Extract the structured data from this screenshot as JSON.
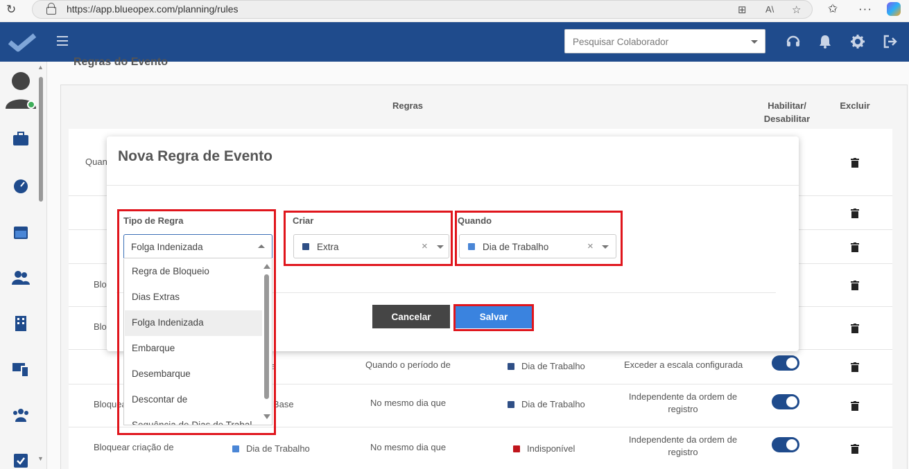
{
  "browser": {
    "url": "https://app.blueopex.com/planning/rules"
  },
  "topnav": {
    "search_placeholder": "Pesquisar Colaborador"
  },
  "page": {
    "section_title": "Regras do Evento",
    "columns": {
      "rules": "Regras",
      "enable": "Habilitar/\nDesabilitar",
      "delete": "Excluir"
    },
    "rows": [
      {
        "c1": "Quan",
        "c2": "",
        "c3": "",
        "c4": "",
        "c5": ""
      },
      {
        "c1": "",
        "c2": "",
        "c3": "",
        "c4": "",
        "c5": ""
      },
      {
        "c1": "",
        "c2": "",
        "c3": "",
        "c4": "",
        "c5": ""
      },
      {
        "c1": "Bloq",
        "c2": "",
        "c3": "",
        "c4": "",
        "c5": ""
      },
      {
        "c1": "Blo",
        "c2": "",
        "c3": "",
        "c4": "",
        "c5": ""
      },
      {
        "c1": "",
        "c2": "bra",
        "c3": "Quando o período de",
        "c4": "Dia de Trabalho",
        "c5": "Exceder a escala configurada"
      },
      {
        "c1": "Bloquea",
        "c2": "o na Base",
        "c3": "No mesmo dia que",
        "c4": "Dia de Trabalho",
        "c5": "Independente da ordem de registro"
      },
      {
        "c1": "Bloquear criação de",
        "c2": "Dia de Trabalho",
        "c3": "No mesmo dia que",
        "c4": "Indisponível",
        "c5": "Independente da ordem de registro"
      }
    ]
  },
  "modal": {
    "title": "Nova Regra de Evento",
    "tipo_label": "Tipo de Regra",
    "tipo_value": "Folga Indenizada",
    "criar_label": "Criar",
    "criar_value": "Extra",
    "quando_label": "Quando",
    "quando_value": "Dia de Trabalho",
    "cancel_label": "Cancelar",
    "save_label": "Salvar",
    "options": [
      "Regra de Bloqueio",
      "Dias Extras",
      "Folga Indenizada",
      "Embarque",
      "Desembarque",
      "Descontar de",
      "Sequência de Dias de Trabal"
    ]
  },
  "colors": {
    "nav": "#1f4b8c",
    "swatch_dark": "#2f4f86",
    "swatch_light": "#4a86d6",
    "swatch_red": "#c0151c",
    "save_button": "#3a83df",
    "highlight": "#e0151c"
  }
}
